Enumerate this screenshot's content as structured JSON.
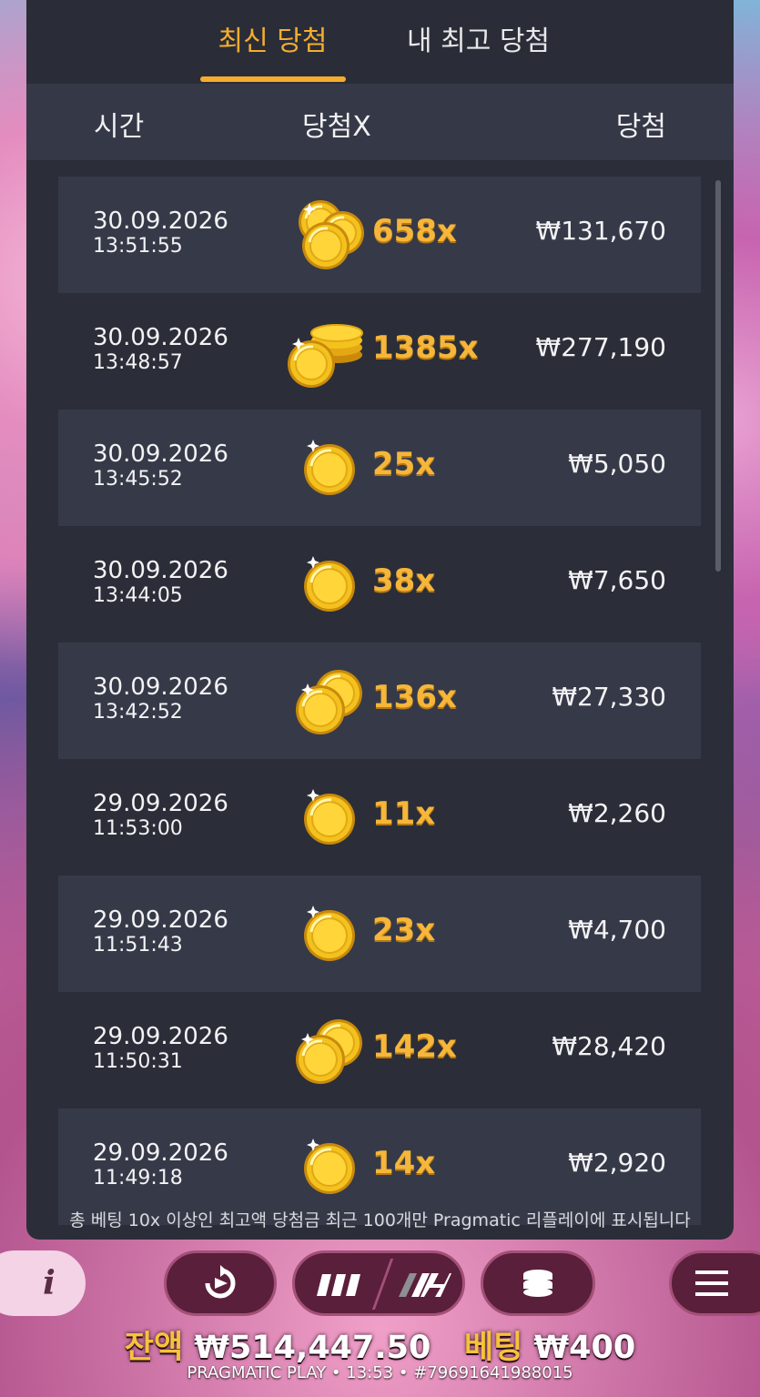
{
  "tabs": [
    {
      "label": "최신 당첨",
      "active": true
    },
    {
      "label": "내 최고 당첨",
      "active": false
    }
  ],
  "columns": {
    "time": "시간",
    "multiplier": "당첨X",
    "win": "당첨"
  },
  "rows": [
    {
      "date": "30.09.2026",
      "time": "13:51:55",
      "multiplier": "658x",
      "win": "₩131,670",
      "coin_icon": "coins-three"
    },
    {
      "date": "30.09.2026",
      "time": "13:48:57",
      "multiplier": "1385x",
      "win": "₩277,190",
      "coin_icon": "coins-stack"
    },
    {
      "date": "30.09.2026",
      "time": "13:45:52",
      "multiplier": "25x",
      "win": "₩5,050",
      "coin_icon": "coin-single"
    },
    {
      "date": "30.09.2026",
      "time": "13:44:05",
      "multiplier": "38x",
      "win": "₩7,650",
      "coin_icon": "coin-single"
    },
    {
      "date": "30.09.2026",
      "time": "13:42:52",
      "multiplier": "136x",
      "win": "₩27,330",
      "coin_icon": "coins-two"
    },
    {
      "date": "29.09.2026",
      "time": "11:53:00",
      "multiplier": "11x",
      "win": "₩2,260",
      "coin_icon": "coin-single"
    },
    {
      "date": "29.09.2026",
      "time": "11:51:43",
      "multiplier": "23x",
      "win": "₩4,700",
      "coin_icon": "coin-single"
    },
    {
      "date": "29.09.2026",
      "time": "11:50:31",
      "multiplier": "142x",
      "win": "₩28,420",
      "coin_icon": "coins-two"
    },
    {
      "date": "29.09.2026",
      "time": "11:49:18",
      "multiplier": "14x",
      "win": "₩2,920",
      "coin_icon": "coin-single"
    }
  ],
  "footnote": "총 베팅 10x 이상인 최고액 당첨금 최근 100개만 Pragmatic 리플레이에 표시됩니다",
  "balance": {
    "label": "잔액",
    "value": "₩514,447.50"
  },
  "bet": {
    "label": "베팅",
    "value": "₩400"
  },
  "meta": "PRAGMATIC PLAY • 13:53 • #79691641988015",
  "colors": {
    "accent": "#f6ad2e",
    "panel": "#2b2e38",
    "row_alt": "#363a48",
    "multiplier": "#f5b63a"
  }
}
